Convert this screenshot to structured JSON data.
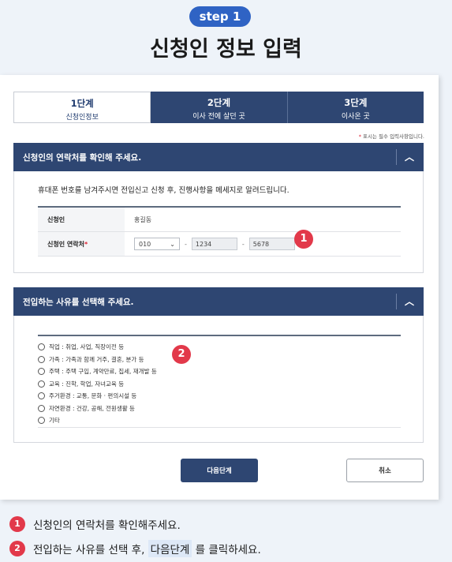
{
  "header": {
    "step_badge": "step 1",
    "title": "신청인 정보 입력"
  },
  "tabs": [
    {
      "label": "1단계",
      "sub": "신청인정보",
      "active": true
    },
    {
      "label": "2단계",
      "sub": "이사 전에 살던 곳",
      "active": false
    },
    {
      "label": "3단계",
      "sub": "이사온 곳",
      "active": false
    }
  ],
  "required_note": {
    "star": "*",
    "text": "표시는 필수 입력사항입니다."
  },
  "section1": {
    "title": "신청인의 연락처를 확인해 주세요.",
    "notice": "휴대폰 번호를 남겨주시면 전입신고 신청 후, 진행사항을 메세지로 알려드립니다.",
    "rows": {
      "name_label": "신청인",
      "name_value": "홍길동",
      "phone_label": "신청인 연락처",
      "phone_star": "*",
      "phone_prefix": "010",
      "phone_mid": "1234",
      "phone_last": "5678",
      "dash": "-"
    }
  },
  "section2": {
    "title": "전입하는 사유를 선택해 주세요.",
    "options": [
      "직업 : 취업, 사업, 직장이전 등",
      "가족 : 가족과 함께 거주, 결혼, 분가 등",
      "주택 : 주택 구입, 계약만료, 집세, 재개발 등",
      "교육 : 진학, 학업, 자녀교육 등",
      "주거환경 : 교통, 문화 · 편의시설 등",
      "자연환경 : 건강, 공해, 전원생활 등",
      "기타"
    ]
  },
  "buttons": {
    "next": "다음단계",
    "cancel": "취소"
  },
  "markers": {
    "m1": "1",
    "m2": "2"
  },
  "instructions": {
    "line1_num": "1",
    "line1": "신청인의 연락처를 확인해주세요.",
    "line2_num": "2",
    "line2_pre": "전입하는 사유를 선택 후,",
    "line2_hl": "다음단계",
    "line2_post": "를 클릭하세요."
  },
  "icons": {
    "collapse": "chevron-up-icon",
    "dropdown": "chevron-down-icon",
    "radio": "radio-icon"
  },
  "colors": {
    "navy": "#2e4672",
    "accent_blue": "#2f63c4",
    "marker_red": "#e2394a"
  }
}
